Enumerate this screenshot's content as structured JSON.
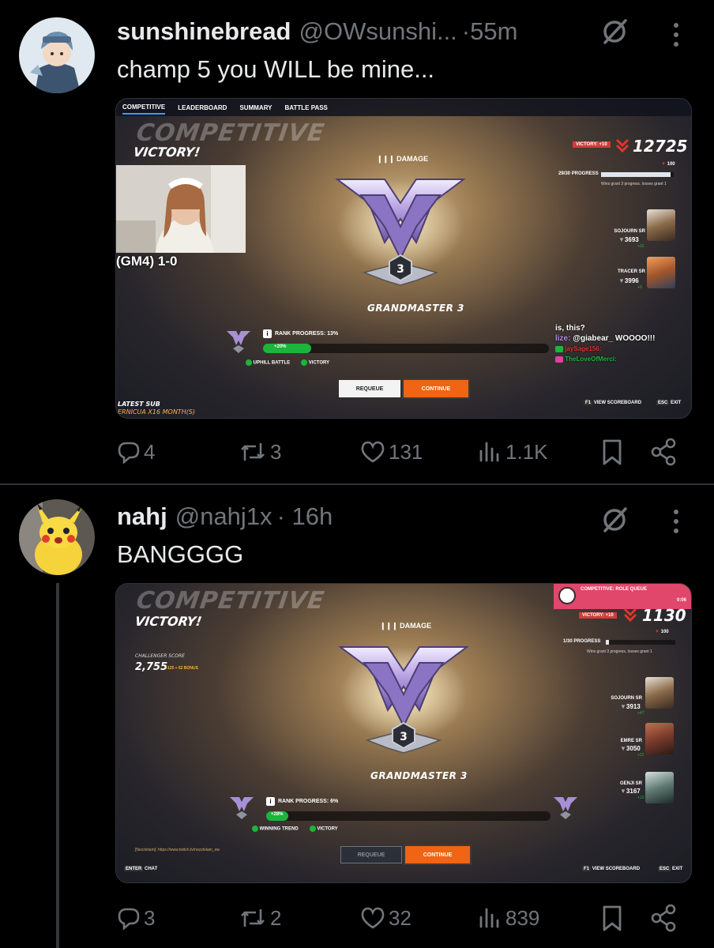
{
  "tweets": [
    {
      "name": "sunshinebread",
      "handle": "@OWsunshi...",
      "time": "·55m",
      "text": "champ 5 you WILL be mine...",
      "media": {
        "tabs": [
          "COMPETITIVE",
          "LEADERBOARD",
          "SUMMARY",
          "BATTLE PASS"
        ],
        "title": "COMPETITIVE",
        "result": "VICTORY!",
        "role": "DAMAGE",
        "division": "3",
        "rank_label": "GRANDMASTER 3",
        "sr_tag": "VICTORY: +10",
        "sr_value": "12725",
        "sr_delta": "100",
        "progress_label": "29/30 PROGRESS",
        "progress_note": "Wins grant 3 progress. losses grant 1",
        "rank_progress": "RANK PROGRESS: 13%",
        "rank_progress_value": 0.13,
        "gain": "+20%",
        "modifiers": [
          "UPHILL BATTLE",
          "VICTORY"
        ],
        "requeue": "REQUEUE",
        "continue": "CONTINUE",
        "view_scoreboard": "VIEW SCOREBOARD",
        "exit": "EXIT",
        "key_view": "F1",
        "key_exit": "ESC",
        "heroes": [
          {
            "label": "SOJOURN SR",
            "value": "3693",
            "delta": "+32",
            "color": "#8a6a4a"
          },
          {
            "label": "TRACER SR",
            "value": "3996",
            "delta": "+9",
            "color": "#a3562b"
          }
        ],
        "overlay_score": "(GM4) 1-0",
        "latest_sub_label": "LATEST SUB",
        "latest_sub_value": "ERNICUA X16 MONTH(S)",
        "chat": {
          "line1": "is, this?",
          "line2_user": "lize:",
          "line2_text": "@giabear_ WOOOO!!!",
          "line3": "jaySage156:",
          "line4": "TheLoveOfMerci:"
        }
      },
      "replies": "4",
      "reposts": "3",
      "likes": "131",
      "views": "1.1K"
    },
    {
      "name": "nahj",
      "handle": "@nahj1x",
      "time": "· 16h",
      "text": "BANGGGG",
      "media": {
        "title": "COMPETITIVE",
        "result": "VICTORY!",
        "role": "DAMAGE",
        "division": "3",
        "rank_label": "GRANDMASTER 3",
        "queue_banner": "COMPETITIVE: ROLE QUEUE",
        "queue_time": "0:06",
        "sr_tag": "VICTORY: +10",
        "sr_value": "1130",
        "sr_delta": "100",
        "progress_label": "1/30 PROGRESS",
        "progress_note": "Wins grant 3 progress, losses grant 1",
        "challenger_label": "CHALLENGER SCORE",
        "challenger_value": "2,755",
        "challenger_bonus": "+125 + 62 BONUS",
        "rank_progress": "RANK PROGRESS: 6%",
        "rank_progress_value": 0.06,
        "gain": "+28%",
        "modifiers": [
          "WINNING TREND",
          "VICTORY"
        ],
        "requeue": "REQUEUE",
        "continue": "CONTINUE",
        "view_scoreboard": "VIEW SCOREBOARD",
        "exit": "EXIT",
        "chat": "CHAT",
        "key_view": "F1",
        "key_exit": "ESC",
        "key_chat": "ENTER",
        "bottom_link": "[Nezzlelam]: https://www.twitch.tv/nezzlelam_ow",
        "heroes": [
          {
            "label": "SOJOURN SR",
            "value": "3913",
            "delta": "+47",
            "color": "#8a6a4a"
          },
          {
            "label": "EMRE SR",
            "value": "3050",
            "delta": "+22",
            "color": "#7a3a2a"
          },
          {
            "label": "GENJI SR",
            "value": "3167",
            "delta": "+10",
            "color": "#5f7a72"
          }
        ]
      },
      "replies": "3",
      "reposts": "2",
      "likes": "32",
      "views": "839"
    }
  ],
  "colors": {
    "text": "#e7e9ea",
    "muted": "#71767b",
    "divider": "#2f3336",
    "continue": "#f06414",
    "progress": "#1ab53c",
    "sr_down": "#e0352b"
  }
}
